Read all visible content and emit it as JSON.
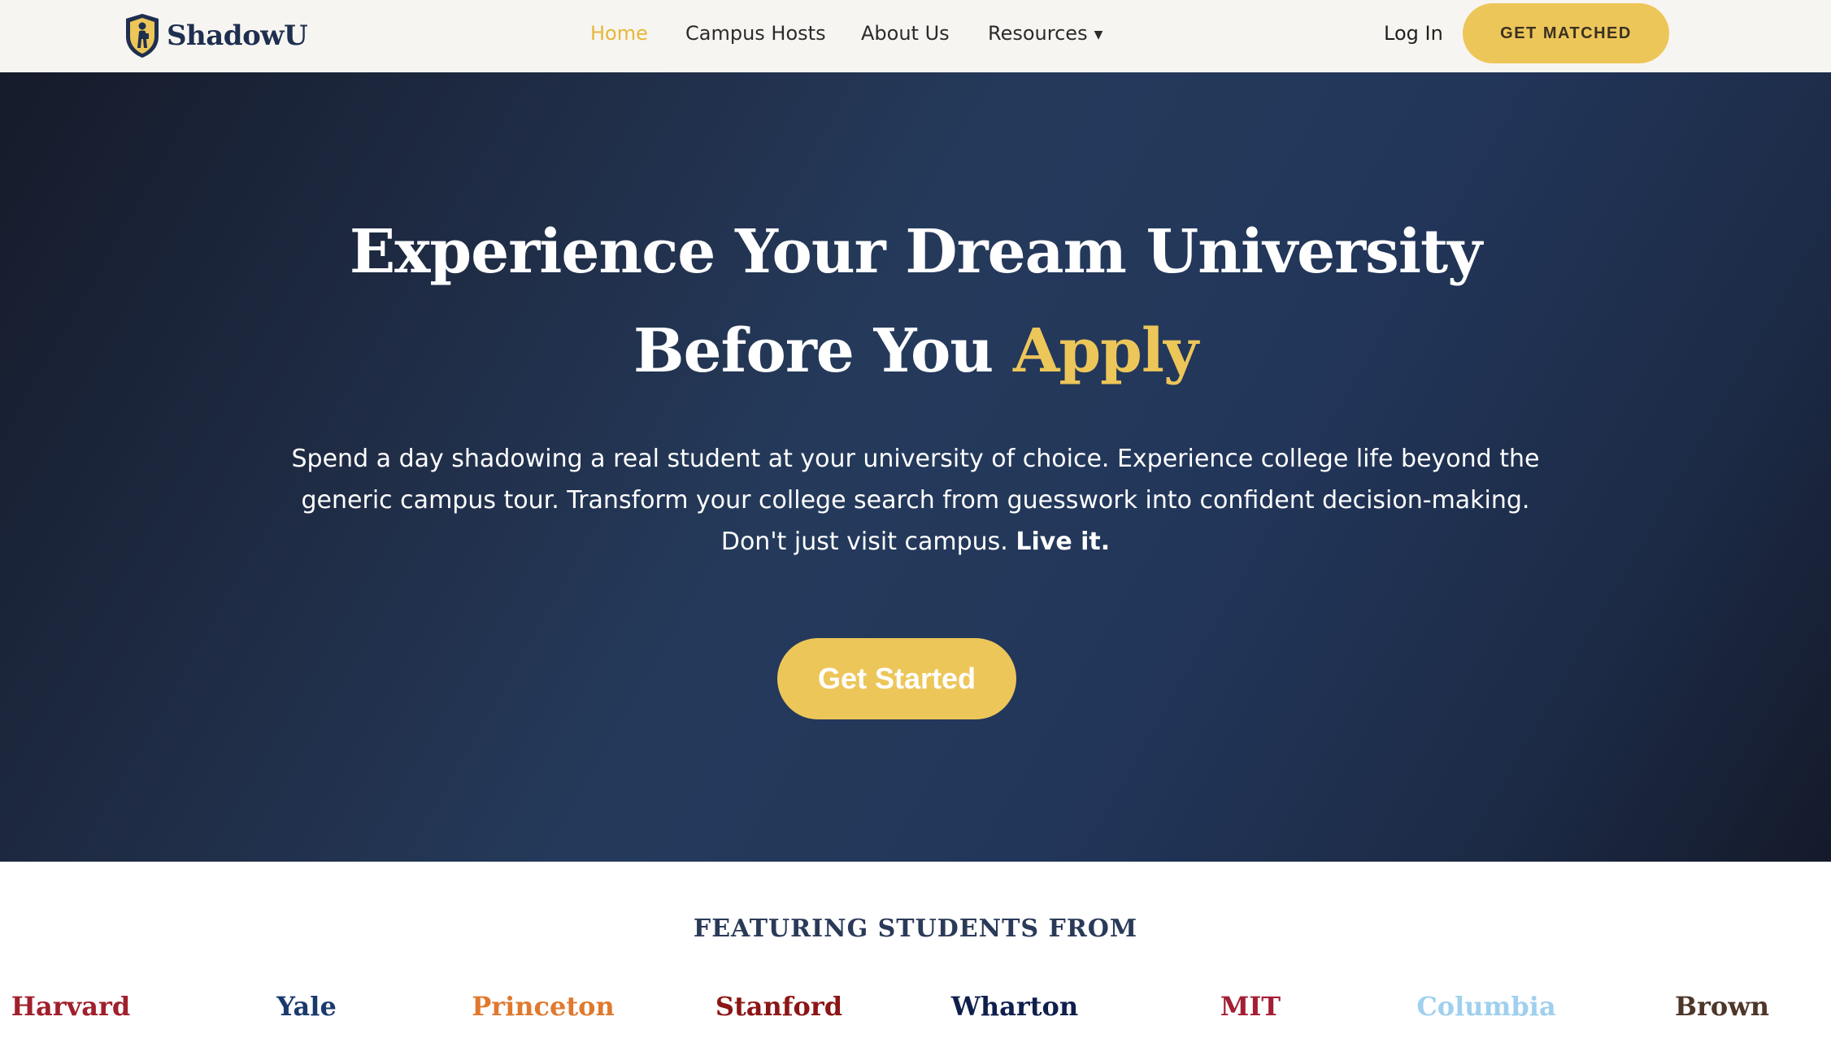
{
  "brand": {
    "name": "ShadowU"
  },
  "nav": {
    "items": [
      {
        "label": "Home",
        "active": true
      },
      {
        "label": "Campus Hosts",
        "active": false
      },
      {
        "label": "About Us",
        "active": false
      },
      {
        "label": "Resources",
        "active": false,
        "dropdown": true
      }
    ],
    "login_label": "Log In",
    "cta_label": "GET MATCHED"
  },
  "hero": {
    "title_line1": "Experience Your Dream University",
    "title_line2_plain": "Before You",
    "title_line2_accent": "Apply",
    "description": "Spend a day shadowing a real student at your university of choice. Experience college life beyond the generic campus tour. Transform your college search from guesswork into confident decision-making. Don't just visit campus.",
    "description_emphasis": "Live it.",
    "button_label": "Get Started"
  },
  "featuring": {
    "title": "FEATURING STUDENTS FROM",
    "universities": [
      {
        "name": "Harvard",
        "color": "#a0202c"
      },
      {
        "name": "Yale",
        "color": "#1a3a6e"
      },
      {
        "name": "Princeton",
        "color": "#e0792e"
      },
      {
        "name": "Stanford",
        "color": "#8c1515"
      },
      {
        "name": "Wharton",
        "color": "#0f1f4d"
      },
      {
        "name": "MIT",
        "color": "#a31f34"
      },
      {
        "name": "Columbia",
        "color": "#9fd0ee"
      },
      {
        "name": "Brown",
        "color": "#4e3629"
      }
    ]
  },
  "colors": {
    "accent": "#edc65a",
    "header_bg": "#f7f5f1",
    "hero_dark": "#1f2c45"
  },
  "icons": {
    "logo": "shield-student-icon",
    "resources_caret": "caret-down-icon"
  }
}
